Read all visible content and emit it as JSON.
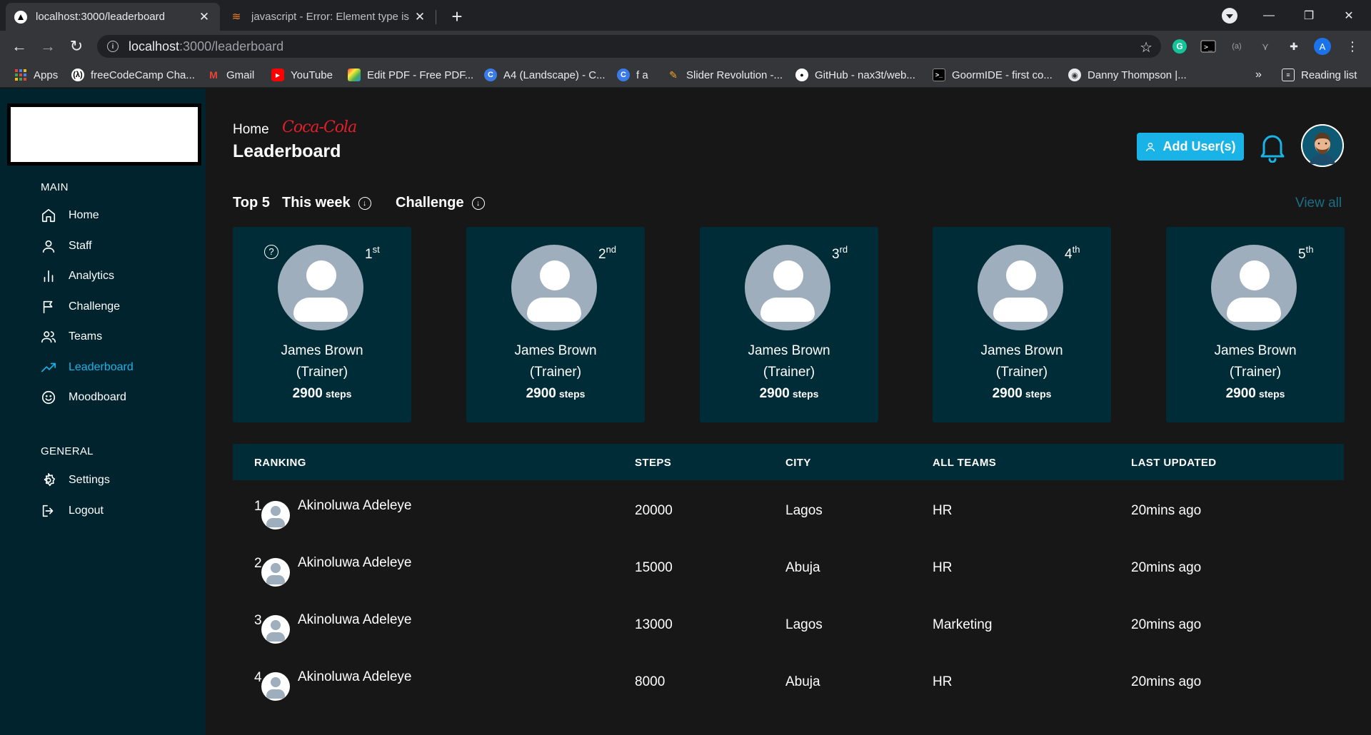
{
  "browser": {
    "tabs": [
      {
        "title": "localhost:3000/leaderboard",
        "active": true
      },
      {
        "title": "javascript - Error: Element type is",
        "active": false
      }
    ],
    "url_host": "localhost",
    "url_path": ":3000/leaderboard",
    "bookmarks": [
      {
        "label": "Apps",
        "icon": "apps-grid-icon"
      },
      {
        "label": "freeCodeCamp Cha...",
        "icon": "freecodecamp-icon"
      },
      {
        "label": "Gmail",
        "icon": "gmail-icon"
      },
      {
        "label": "YouTube",
        "icon": "youtube-icon"
      },
      {
        "label": "Edit PDF - Free PDF...",
        "icon": "pdf-icon"
      },
      {
        "label": "A4 (Landscape) - C...",
        "icon": "canva-icon"
      },
      {
        "label": "f a",
        "icon": "canva-icon"
      },
      {
        "label": "Slider Revolution -...",
        "icon": "slider-icon"
      },
      {
        "label": "GitHub - nax3t/web...",
        "icon": "github-icon"
      },
      {
        "label": "GoormIDE - first co...",
        "icon": "terminal-icon"
      },
      {
        "label": "Danny Thompson |...",
        "icon": "chrome-icon"
      }
    ],
    "bookmarks_overflow": "»",
    "reading_list": "Reading list",
    "profile_initial": "A"
  },
  "sidebar": {
    "main_heading": "MAIN",
    "main_items": [
      {
        "label": "Home",
        "icon": "home-icon"
      },
      {
        "label": "Staff",
        "icon": "user-icon"
      },
      {
        "label": "Analytics",
        "icon": "bar-chart-icon"
      },
      {
        "label": "Challenge",
        "icon": "flag-icon"
      },
      {
        "label": "Teams",
        "icon": "users-icon"
      },
      {
        "label": "Leaderboard",
        "icon": "trending-up-icon",
        "active": true
      },
      {
        "label": "Moodboard",
        "icon": "smile-icon"
      }
    ],
    "general_heading": "GENERAL",
    "general_items": [
      {
        "label": "Settings",
        "icon": "gear-icon"
      },
      {
        "label": "Logout",
        "icon": "logout-icon"
      }
    ]
  },
  "header": {
    "breadcrumb_home": "Home",
    "brand": "Coca-Cola",
    "title": "Leaderboard",
    "add_user_label": "Add User(s)"
  },
  "filters": {
    "top_label": "Top 5",
    "period": "This week",
    "category": "Challenge",
    "view_all": "View all"
  },
  "top_cards": [
    {
      "rank": "1",
      "suffix": "st",
      "name": "James Brown",
      "role": "(Trainer)",
      "steps": "2900",
      "unit": "steps"
    },
    {
      "rank": "2",
      "suffix": "nd",
      "name": "James Brown",
      "role": "(Trainer)",
      "steps": "2900",
      "unit": "steps"
    },
    {
      "rank": "3",
      "suffix": "rd",
      "name": "James Brown",
      "role": "(Trainer)",
      "steps": "2900",
      "unit": "steps"
    },
    {
      "rank": "4",
      "suffix": "th",
      "name": "James Brown",
      "role": "(Trainer)",
      "steps": "2900",
      "unit": "steps"
    },
    {
      "rank": "5",
      "suffix": "th",
      "name": "James Brown",
      "role": "(Trainer)",
      "steps": "2900",
      "unit": "steps"
    }
  ],
  "table": {
    "columns": [
      "RANKING",
      "STEPS",
      "CITY",
      "ALL TEAMS",
      "LAST UPDATED"
    ],
    "rows": [
      {
        "rank": "1",
        "name": "Akinoluwa Adeleye",
        "steps": "20000",
        "city": "Lagos",
        "team": "HR",
        "updated": "20mins ago"
      },
      {
        "rank": "2",
        "name": "Akinoluwa Adeleye",
        "steps": "15000",
        "city": "Abuja",
        "team": "HR",
        "updated": "20mins ago"
      },
      {
        "rank": "3",
        "name": "Akinoluwa Adeleye",
        "steps": "13000",
        "city": "Lagos",
        "team": "Marketing",
        "updated": "20mins ago"
      },
      {
        "rank": "4",
        "name": "Akinoluwa Adeleye",
        "steps": "8000",
        "city": "Abuja",
        "team": "HR",
        "updated": "20mins ago"
      }
    ]
  },
  "colors": {
    "accent": "#1ab3e8",
    "sidebar_bg": "#00232e",
    "card_bg": "#002c38",
    "page_bg": "#171717",
    "brand_red": "#e41e2b"
  }
}
